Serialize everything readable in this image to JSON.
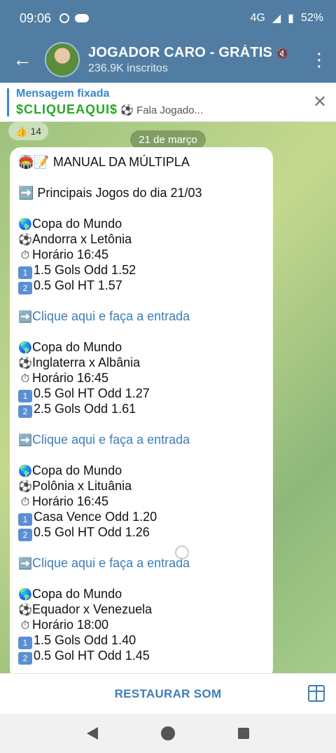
{
  "status": {
    "time": "09:06",
    "network": "4G",
    "battery": "52%"
  },
  "header": {
    "title": "JOGADOR CARO - GRÁTIS",
    "subtitle": "236.9K inscritos"
  },
  "pinned": {
    "label": "Mensagem fixada",
    "preview_highlight": "$CLIQUEAQUI$",
    "preview_text": "⚽ Fala Jogado..."
  },
  "chat": {
    "reaction": {
      "emoji": "👍",
      "count": "14"
    },
    "date": "21 de março",
    "message": {
      "title": "🏟️📝 MANUAL DA MÚLTIPLA",
      "intro": "➡️ Principais Jogos do dia 21/03",
      "games": [
        {
          "competition": "Copa do Mundo",
          "match": "Andorra x Letônia",
          "time": "Horário 16:45",
          "tip1": "1.5 Gols Odd 1.52",
          "tip2": "0.5 Gol HT 1.57",
          "link": "Clique aqui e faça a entrada"
        },
        {
          "competition": "Copa do Mundo",
          "match": "Inglaterra x Albânia",
          "time": "Horário 16:45",
          "tip1": "0.5 Gol HT Odd 1.27",
          "tip2": "2.5 Gols Odd 1.61",
          "link": "Clique aqui e faça a entrada"
        },
        {
          "competition": "Copa do Mundo",
          "match": "Polônia x Lituânia",
          "time": "Horário 16:45",
          "tip1": "Casa Vence Odd 1.20",
          "tip2": "0.5 Gol HT Odd 1.26",
          "link": "Clique aqui e faça a entrada"
        },
        {
          "competition": "Copa do Mundo",
          "match": "Equador x Venezuela",
          "time": "Horário 18:00",
          "tip1": "1.5 Gols Odd 1.40",
          "tip2": "0.5 Gol HT Odd 1.45"
        }
      ]
    }
  },
  "bottom": {
    "restore_label": "RESTAURAR SOM"
  },
  "icons": [
    "back-arrow-icon",
    "more-vert-icon",
    "close-icon",
    "gift-icon"
  ]
}
